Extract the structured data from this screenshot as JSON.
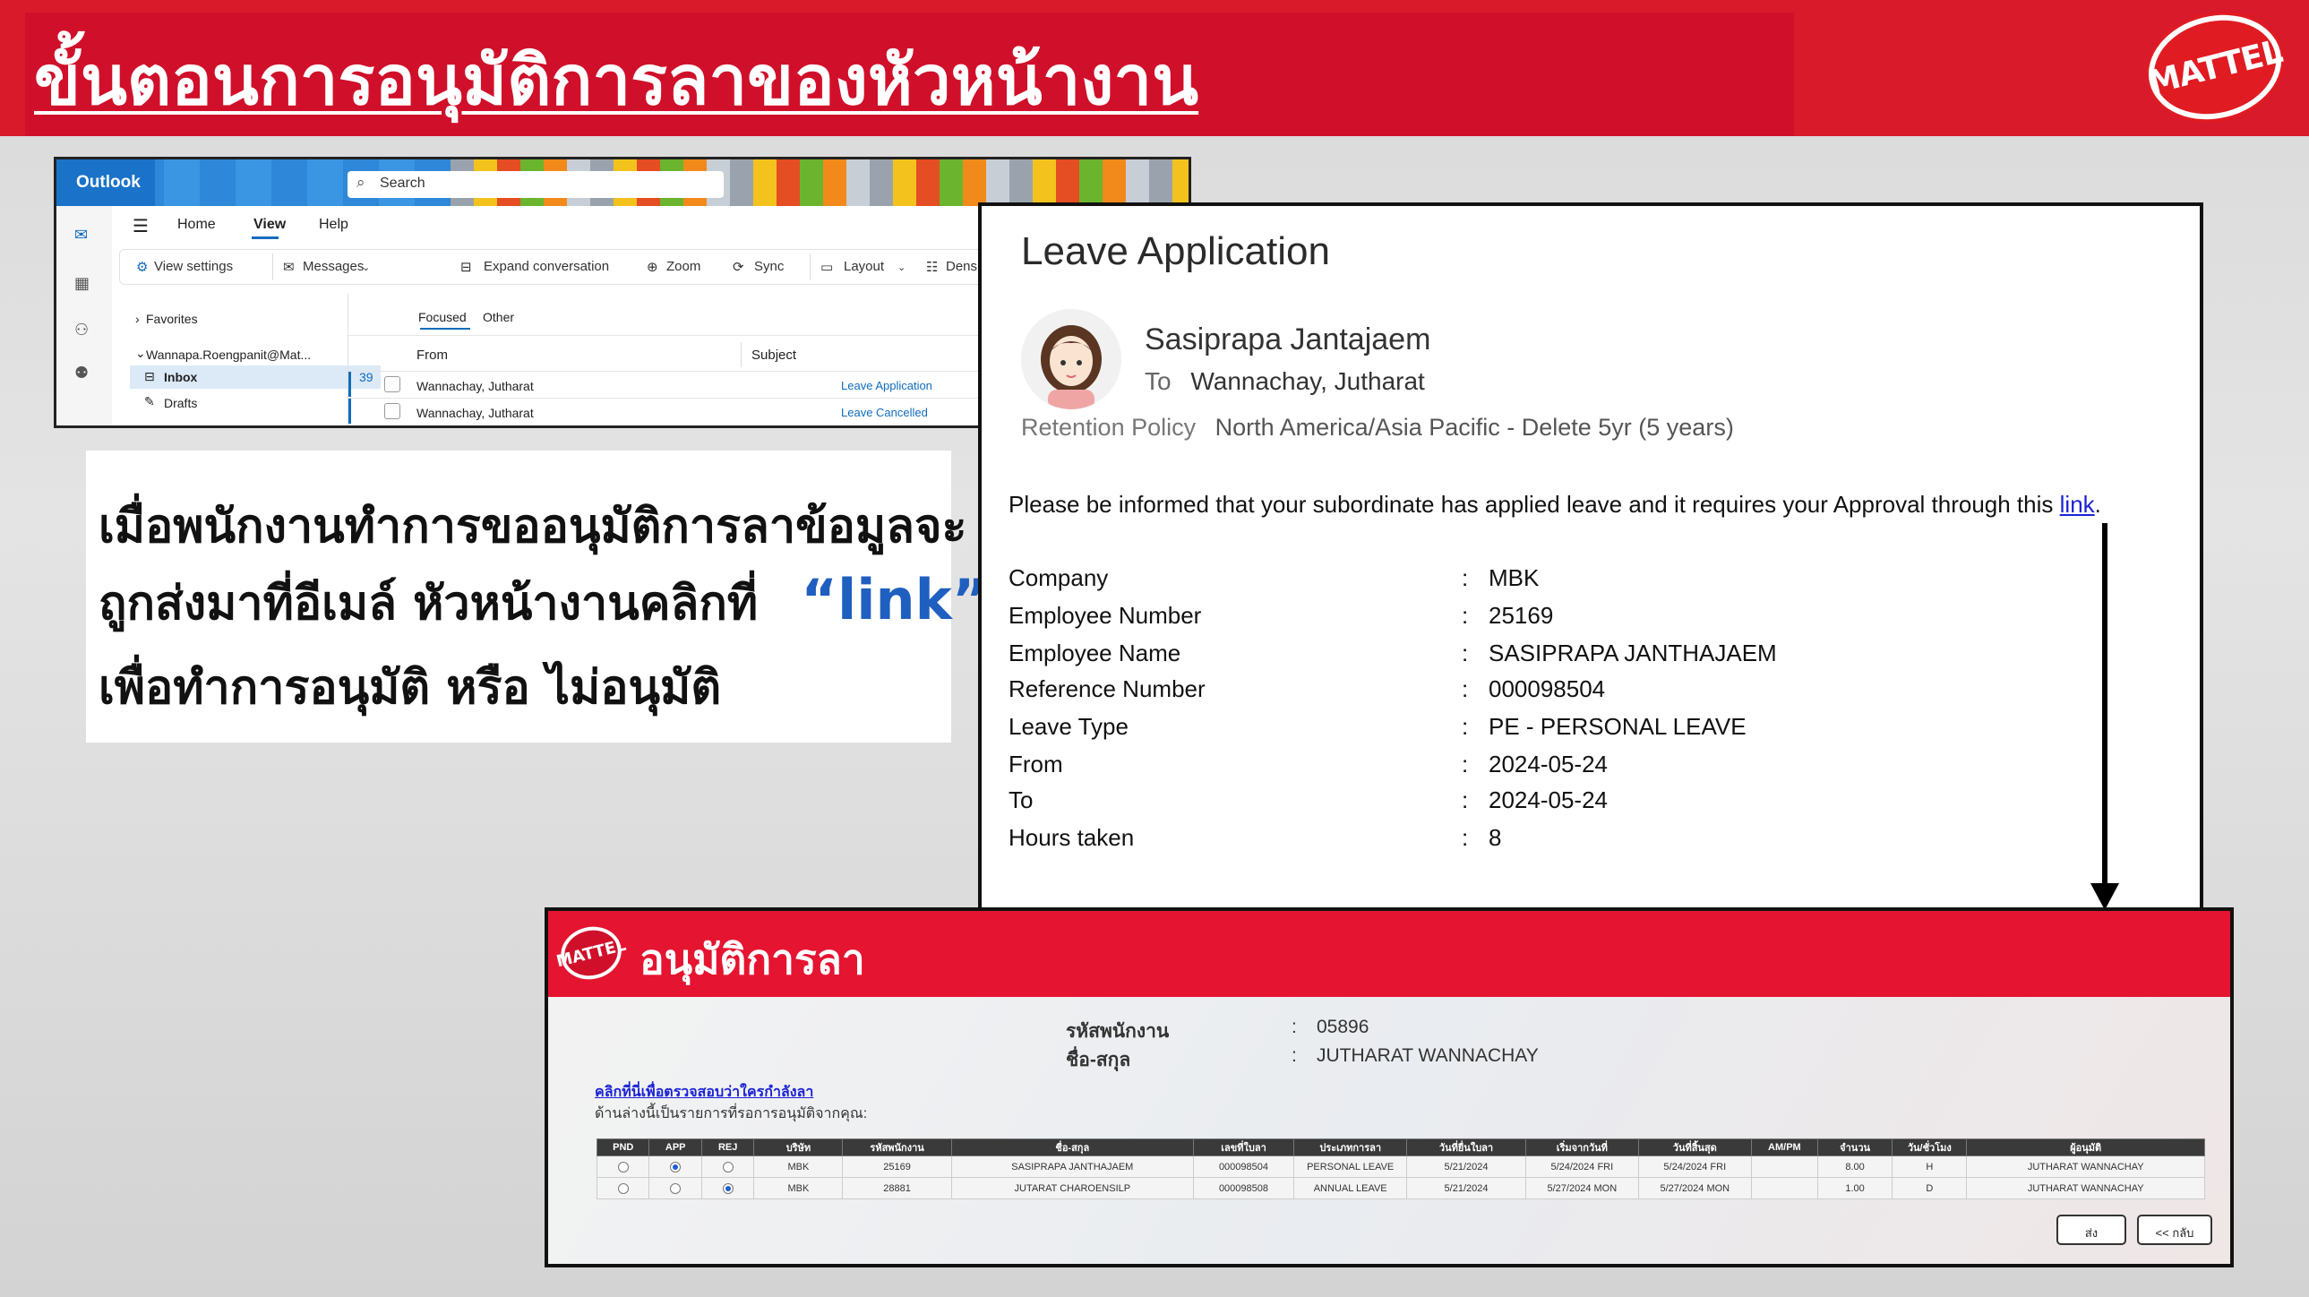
{
  "slide": {
    "title": "ขั้นตอนการอนุมัติการลาของหัวหน้างาน",
    "logo_text": "MATTEL",
    "colors": {
      "banner": "#d81a2b",
      "link_blue": "#1f5fbf"
    }
  },
  "outlook": {
    "brand": "Outlook",
    "search_placeholder": "Search",
    "menu": {
      "home": "Home",
      "view": "View",
      "help": "Help"
    },
    "ribbon": {
      "view_settings": "View settings",
      "messages": "Messages",
      "expand_conversation": "Expand conversation",
      "zoom": "Zoom",
      "sync": "Sync",
      "layout": "Layout",
      "density": "Density"
    },
    "sidebar": {
      "favorites": "Favorites",
      "account": "Wannapa.Roengpanit@Mat...",
      "inbox": "Inbox",
      "inbox_count": "39",
      "drafts": "Drafts"
    },
    "list": {
      "tab_focused": "Focused",
      "tab_other": "Other",
      "col_from": "From",
      "col_subject": "Subject",
      "rows": [
        {
          "from": "Wannachay, Jutharat",
          "subject": "Leave Application"
        },
        {
          "from": "Wannachay, Jutharat",
          "subject": "Leave Cancelled"
        }
      ]
    }
  },
  "instruction": {
    "line1": "เมื่อพนักงานทำการขออนุมัติการลาข้อมูลจะ",
    "line2a": "ถูกส่งมาที่อีเมล์  หัวหน้างานคลิกที่",
    "line2b": "“link”",
    "line3": "เพื่อทำการอนุมัติ หรือ ไม่อนุมัติ"
  },
  "email": {
    "title": "Leave Application",
    "sender": "Sasiprapa Jantajaem",
    "to_label": "To",
    "to": "Wannachay, Jutharat",
    "retention_label": "Retention Policy",
    "retention": "North America/Asia Pacific - Delete 5yr (5 years)",
    "notice": "Please be informed that your subordinate has applied leave and it requires your Approval through this",
    "link_text": "link",
    "notice_end": ".",
    "fields": [
      {
        "label": "Company",
        "value": "MBK"
      },
      {
        "label": "Employee Number",
        "value": "25169"
      },
      {
        "label": "Employee Name",
        "value": "SASIPRAPA JANTHAJAEM"
      },
      {
        "label": "Reference Number",
        "value": "000098504"
      },
      {
        "label": "Leave Type",
        "value": "PE - PERSONAL LEAVE"
      },
      {
        "label": "From",
        "value": "2024-05-24"
      },
      {
        "label": "To",
        "value": "2024-05-24"
      },
      {
        "label": "Hours taken",
        "value": "8"
      }
    ]
  },
  "approval": {
    "logo_text": "MATTEL",
    "title": "อนุมัติการลา",
    "emp_code_label": "รหัสพนักงาน",
    "emp_code": "05896",
    "name_label": "ชื่อ-สกุล",
    "name": "JUTHARAT WANNACHAY",
    "check_link": "คลิกที่นี่เพื่อตรวจสอบว่าใครกำลังลา",
    "subtitle": "ด้านล่างนี้เป็นรายการที่รอการอนุมัติจากคุณ:",
    "columns": [
      "PND",
      "APP",
      "REJ",
      "บริษัท",
      "รหัสพนักงาน",
      "ชื่อ-สกุล",
      "เลขที่ใบลา",
      "ประเภทการลา",
      "วันที่ยื่นใบลา",
      "เริ่มจากวันที่",
      "วันที่สิ้นสุด",
      "AM/PM",
      "จำนวน",
      "วัน/ชั่วโมง",
      "ผู้อนุมัติ"
    ],
    "rows": [
      {
        "selected": "APP",
        "cells": [
          "MBK",
          "25169",
          "SASIPRAPA JANTHAJAEM",
          "000098504",
          "PERSONAL LEAVE",
          "5/21/2024",
          "5/24/2024 FRI",
          "5/24/2024 FRI",
          "",
          "8.00",
          "H",
          "JUTHARAT WANNACHAY"
        ]
      },
      {
        "selected": "REJ",
        "cells": [
          "MBK",
          "28881",
          "JUTARAT CHAROENSILP",
          "000098508",
          "ANNUAL LEAVE",
          "5/21/2024",
          "5/27/2024 MON",
          "5/27/2024 MON",
          "",
          "1.00",
          "D",
          "JUTHARAT WANNACHAY"
        ]
      }
    ],
    "submit_label": "ส่ง",
    "back_label": "<< กลับ"
  }
}
